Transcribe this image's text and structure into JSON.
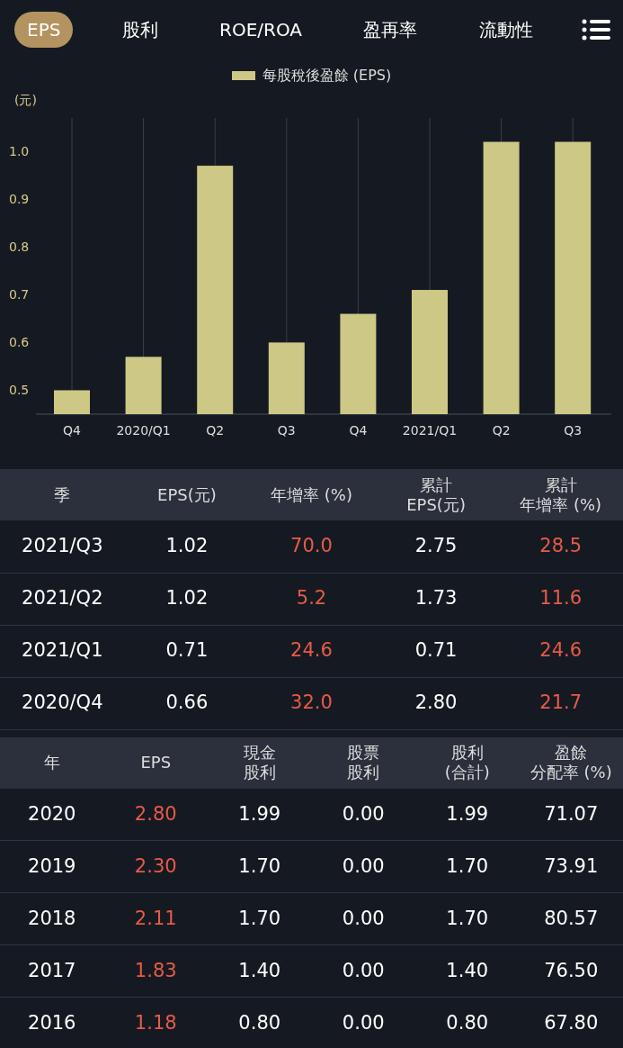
{
  "tabs": [
    {
      "label": "EPS",
      "selected": true
    },
    {
      "label": "股利",
      "selected": false
    },
    {
      "label": "ROE/ROA",
      "selected": false
    },
    {
      "label": "盈再率",
      "selected": false
    },
    {
      "label": "流動性",
      "selected": false
    }
  ],
  "chart": {
    "chart_data": {
      "type": "bar",
      "ylabel": "(元)",
      "categories": [
        "Q4",
        "2020/Q1",
        "Q2",
        "Q3",
        "Q4",
        "2021/Q1",
        "Q2",
        "Q3"
      ],
      "ylim": [
        0.45,
        1.07
      ],
      "yticks": [
        0.5,
        0.6,
        0.7,
        0.8,
        0.9,
        {
          "value": 1,
          "label": "1.0"
        }
      ],
      "grid": true,
      "series": [
        {
          "name": "每股稅後盈餘 (EPS)",
          "color": "#cdc886",
          "values": [
            0.5,
            0.57,
            0.97,
            0.6,
            0.66,
            0.71,
            1.02,
            1.02
          ]
        }
      ]
    }
  },
  "quarter_table": {
    "columns": [
      {
        "label": "季",
        "kind": "plain"
      },
      {
        "label": "EPS(元)",
        "kind": "plain"
      },
      {
        "label": "年增率 (%)",
        "kind": "growth"
      },
      {
        "lines": [
          "累計",
          "EPS(元)"
        ],
        "kind": "plain"
      },
      {
        "lines": [
          "累計",
          "年增率 (%)"
        ],
        "kind": "growth"
      }
    ],
    "rows": [
      [
        "2021/Q3",
        "1.02",
        "70.0",
        "2.75",
        "28.5"
      ],
      [
        "2021/Q2",
        "1.02",
        "5.2",
        "1.73",
        "11.6"
      ],
      [
        "2021/Q1",
        "0.71",
        "24.6",
        "0.71",
        "24.6"
      ],
      [
        "2020/Q4",
        "0.66",
        "32.0",
        "2.80",
        "21.7"
      ]
    ]
  },
  "year_table": {
    "columns": [
      {
        "label": "年",
        "kind": "plain"
      },
      {
        "label": "EPS",
        "kind": "growth"
      },
      {
        "lines": [
          "現金",
          "股利"
        ],
        "kind": "plain"
      },
      {
        "lines": [
          "股票",
          "股利"
        ],
        "kind": "plain"
      },
      {
        "lines": [
          "股利",
          "(合計)"
        ],
        "kind": "plain"
      },
      {
        "lines": [
          "盈餘",
          "分配率 (%)"
        ],
        "kind": "plain"
      }
    ],
    "rows": [
      [
        "2020",
        "2.80",
        "1.99",
        "0.00",
        "1.99",
        "71.07"
      ],
      [
        "2019",
        "2.30",
        "1.70",
        "0.00",
        "1.70",
        "73.91"
      ],
      [
        "2018",
        "2.11",
        "1.70",
        "0.00",
        "1.70",
        "80.57"
      ],
      [
        "2017",
        "1.83",
        "1.40",
        "0.00",
        "1.40",
        "76.50"
      ],
      [
        "2016",
        "1.18",
        "0.80",
        "0.00",
        "0.80",
        "67.80"
      ]
    ]
  }
}
